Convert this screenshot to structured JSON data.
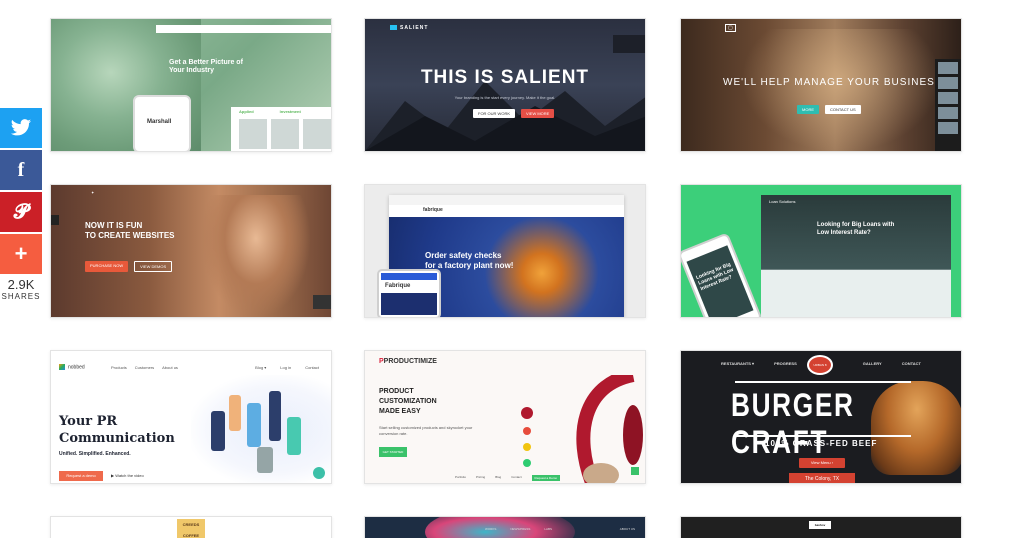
{
  "share_bar": {
    "twitter_icon": "twitter-icon",
    "facebook_icon": "facebook-icon",
    "pinterest_icon": "pinterest-icon",
    "more_icon": "plus-icon",
    "count": "2.9K",
    "label": "SHARES",
    "colors": {
      "twitter": "#1da1f2",
      "facebook": "#3b5998",
      "pinterest": "#cb2027",
      "more": "#f55d40"
    }
  },
  "cards": {
    "marshall": {
      "hero": "Get a Better Picture of Your Industry",
      "phone_brand": "Marshall",
      "label_a": "Applied",
      "label_b": "Investment"
    },
    "salient": {
      "logo": "SALIENT",
      "title": "THIS IS SALIENT",
      "subtitle": "Your branding is the start every journey. Make it the goal.",
      "btn_a": "FOR OUR WORK",
      "btn_b": "VIEW MORE"
    },
    "manage": {
      "title": "WE'LL HELP MANAGE YOUR BUSINESS",
      "btn_a": "MORE",
      "btn_b": "CONTACT US"
    },
    "fun": {
      "hero_line1": "NOW IT IS FUN",
      "hero_line2": "TO CREATE WEBSITES",
      "btn_a": "PURCHASE NOW",
      "btn_b": "VIEW DEMOS"
    },
    "fabrique": {
      "logo": "fabrique",
      "hero_line1": "Order safety checks",
      "hero_line2": "for a factory plant now!",
      "phone_brand": "Fabrique"
    },
    "loans": {
      "logo": "Loan Solutions",
      "hero_line1": "Looking for Big Loans with",
      "hero_line2": "Low Interest Rate?",
      "phone_text": "Looking for Big Loans with Low Interest Rate?"
    },
    "pr": {
      "logo": "nobbed",
      "nav": [
        "Products",
        "Customers",
        "About us"
      ],
      "nav_right": [
        "Blog ▾",
        "Log in",
        "Contact"
      ],
      "title_line1": "Your PR",
      "title_line2": "Communication",
      "subtitle": "Unified. Simplified. Enhanced.",
      "button": "Request a demo",
      "watch": "Watch the video"
    },
    "productimize": {
      "logo_mark": "P",
      "logo_text": "PRODUCTIMIZE",
      "title_line1": "PRODUCT",
      "title_line2": "CUSTOMIZATION",
      "title_line3": "MADE EASY",
      "subtitle": "Start selling customized products and skyrocket your conversion rate.",
      "button": "GET STARTED",
      "footer": [
        "Portfolio",
        "Pricing",
        "Blog",
        "Contact",
        "Request a Demo"
      ]
    },
    "burger": {
      "nav": [
        "RESTAURANTS ▾",
        "PROGRESS",
        "GALLERY",
        "CONTACT"
      ],
      "badge": "URBAN 8",
      "title": "BURGER CRAFT",
      "subtitle": "100% GRASS-FED BEEF",
      "button": "View Menu ›",
      "location": "The Colony, TX"
    },
    "creeds": {
      "logo": "CREEDS COFFEE"
    },
    "art": {
      "nav": [
        "WORKS",
        "NEWS/PRESS",
        "LABS"
      ],
      "nav_right": "ABOUT US"
    },
    "dark": {
      "logo": "baxhov"
    }
  }
}
